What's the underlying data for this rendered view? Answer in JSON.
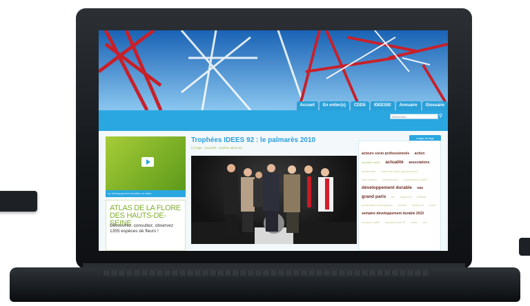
{
  "nav": {
    "tabs": [
      "Accueil",
      "En entier(s)",
      "CDDS",
      "IDEES92",
      "Annuaire",
      "Glossaire"
    ]
  },
  "search": {
    "placeholder": "Rechercher..."
  },
  "left": {
    "video_caption": "Le développement durable en vidéo",
    "atlas_title_1": "ATLAS DE LA FLORE",
    "atlas_title_2": "DES HAUTS-DE-SEINE",
    "atlas_text": "Découvrez, consultez, observez 1355 espèces de fleurs !"
  },
  "article": {
    "title": "Trophées IDEES 92 : le palmarès 2010",
    "tags": "[+] Tags : actualité - trophée ideas 92"
  },
  "tags": {
    "button": "nuage de tags",
    "cloud": [
      {
        "text": "acteurs socio professionnels",
        "size": "s"
      },
      {
        "text": "action",
        "size": "s"
      },
      {
        "text": "actualité cdd92",
        "size": "g"
      },
      {
        "text": "actualité",
        "size": "m"
      },
      {
        "text": "associations",
        "size": "s"
      },
      {
        "text": "biodiversité",
        "size": "xs"
      },
      {
        "text": "charte de bonne gouvernance",
        "size": "xs"
      },
      {
        "text": "club ideas92",
        "size": "xs"
      },
      {
        "text": "commissions",
        "size": "xs"
      },
      {
        "text": "commissions cdd92",
        "size": "xs"
      },
      {
        "text": "développement durable",
        "size": "m"
      },
      {
        "text": "eau",
        "size": "s"
      },
      {
        "text": "grand paris",
        "size": "m"
      },
      {
        "text": "jeu",
        "size": "xs"
      },
      {
        "text": "logement",
        "size": "xs"
      },
      {
        "text": "mobilité",
        "size": "xs"
      },
      {
        "text": "performance énergétique",
        "size": "xs"
      },
      {
        "text": "planète",
        "size": "xs"
      },
      {
        "text": "qualité air",
        "size": "xs"
      },
      {
        "text": "santé",
        "size": "xs"
      },
      {
        "text": "semaine développement durable 2010",
        "size": "s"
      },
      {
        "text": "seminar cdd92",
        "size": "xs"
      },
      {
        "text": "trophée ideas 92",
        "size": "xs"
      },
      {
        "text": "vente",
        "size": "xs"
      },
      {
        "text": "eau",
        "size": "xs"
      }
    ]
  }
}
